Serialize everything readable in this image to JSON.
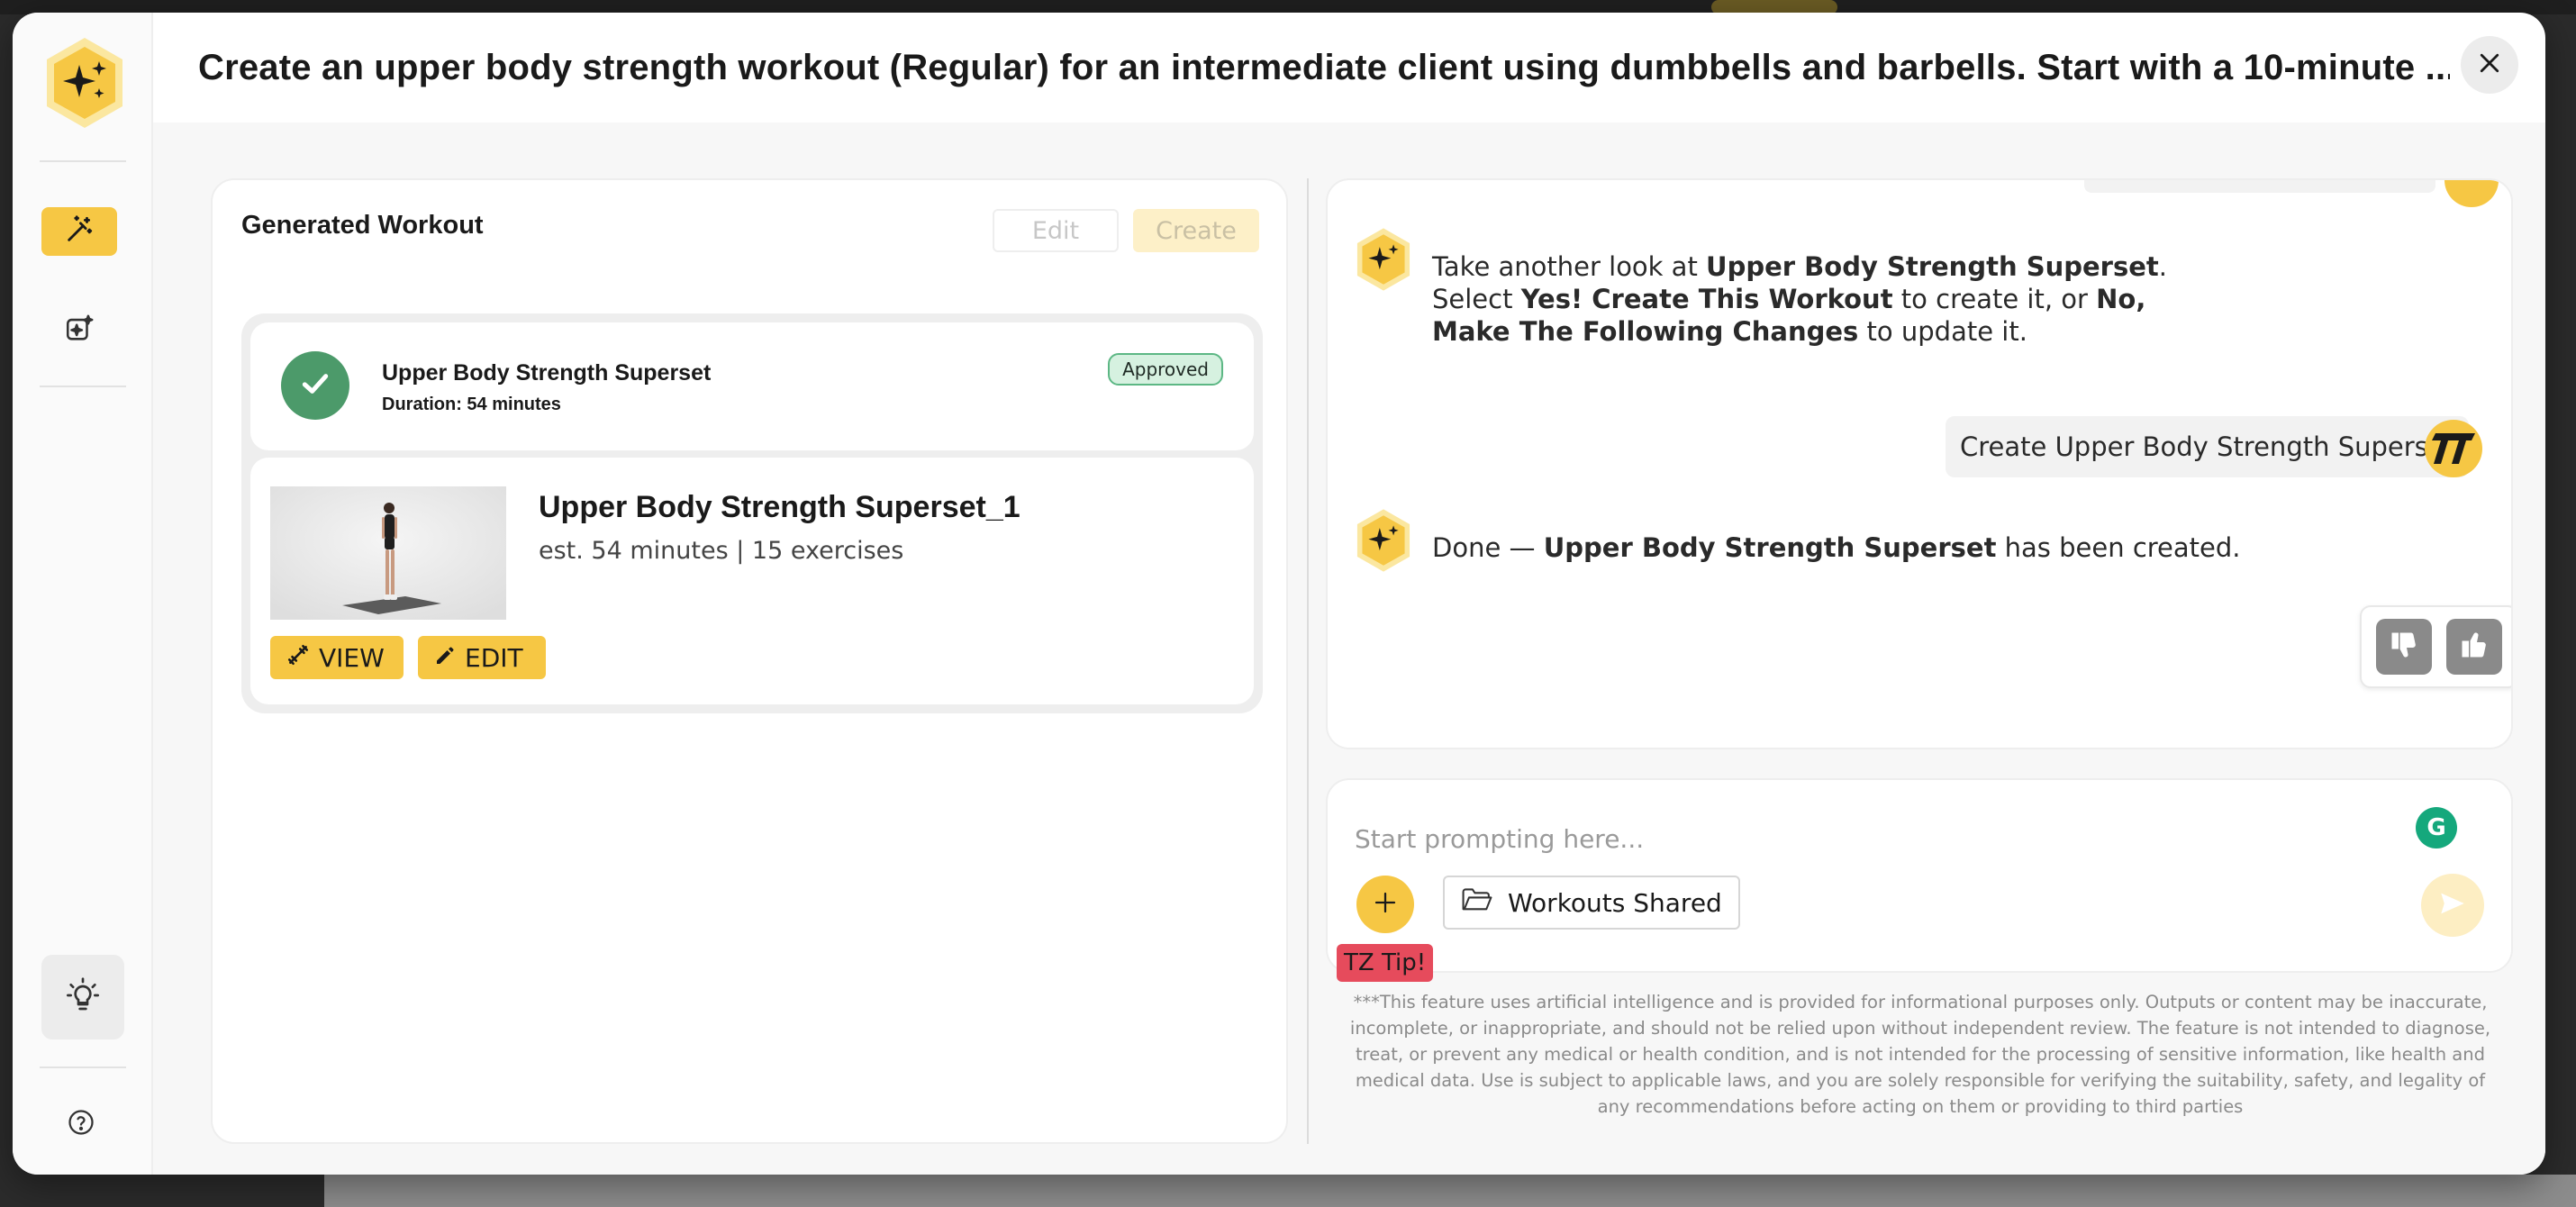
{
  "modal": {
    "title": "Create an upper body strength workout (Regular) for an intermediate client using dumbbells and barbells. Start with a 10-minute ..."
  },
  "left_panel": {
    "title": "Generated Workout",
    "edit_label": "Edit",
    "create_label": "Create",
    "workout": {
      "name": "Upper Body Strength Superset",
      "duration": "Duration: 54 minutes",
      "status": "Approved"
    },
    "variant": {
      "name": "Upper Body Strength Superset_1",
      "meta": "est. 54 minutes | 15 exercises",
      "view_label": "VIEW",
      "edit_label": "EDIT"
    }
  },
  "chat": {
    "msg1": {
      "p1": "Take another look at ",
      "b1": "Upper Body Strength Superset",
      "p2": ". Select ",
      "b2": "Yes! Create This Workout",
      "p3": " to create it, or ",
      "b3": "No, Make The Following Changes",
      "p4": " to update it."
    },
    "user_msg": "Create Upper Body Strength Superset",
    "msg2": {
      "p1": "Done — ",
      "b1": "Upper Body Strength Superset",
      "p2": " has been created."
    }
  },
  "input": {
    "placeholder": "Start prompting here...",
    "folder_label": "Workouts Shared",
    "tip_label": "TZ Tip!"
  },
  "disclaimer": "***This feature uses artificial intelligence and is provided for informational purposes only. Outputs or content may be inaccurate, incomplete, or inappropriate, and should not be relied upon without independent review. The feature is not intended to diagnose, treat, or prevent any medical or health condition, and is not intended for the processing of sensitive information, like health and medical data. Use is subject to applicable laws, and you are solely responsible for verifying the suitability, safety, and legality of any recommendations before acting on them or providing to third parties",
  "colors": {
    "accent": "#f6c744",
    "success": "#4c9a6a",
    "tip": "#e64b5c"
  },
  "icons": {
    "logo": "sparkle-hexagon-icon",
    "rail_active": "magic-wand-icon",
    "rail_second": "sparkle-image-icon",
    "rail_tip": "lightbulb-icon",
    "rail_help": "question-circle-icon",
    "close": "close-icon",
    "check": "check-icon",
    "view": "dumbbell-icon",
    "edit": "pencil-icon",
    "dislike": "thumbs-down-icon",
    "like": "thumbs-up-icon",
    "add": "plus-icon",
    "folder": "folder-icon",
    "send": "send-icon"
  }
}
